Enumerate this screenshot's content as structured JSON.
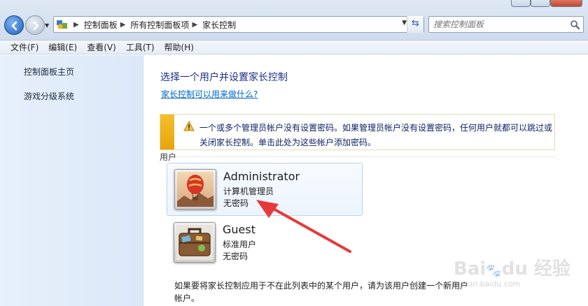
{
  "addressbar": {
    "breadcrumbs": [
      "控制面板",
      "所有控制面板项",
      "家长控制"
    ],
    "search_placeholder": "搜索控制面板"
  },
  "menubar": [
    "文件(F)",
    "编辑(E)",
    "查看(V)",
    "工具(T)",
    "帮助(H)"
  ],
  "sidebar": {
    "items": [
      {
        "label": "控制面板主页"
      },
      {
        "label": "游戏分级系统"
      }
    ]
  },
  "main": {
    "heading": "选择一个用户并设置家长控制",
    "help_link": "家长控制可以用来做什么?",
    "warning": "一个或多个管理员帐户没有设置密码。如果管理员帐户没有设置密码，任何用户就都可以跳过或关闭家长控制。单击此处为这些帐户添加密码。",
    "section_label": "用户",
    "users": [
      {
        "name": "Administrator",
        "role": "计算机管理员",
        "password": "无密码",
        "avatar": "hot-air-balloon"
      },
      {
        "name": "Guest",
        "role": "标准用户",
        "password": "无密码",
        "avatar": "suitcase"
      }
    ],
    "footnote": "如果要将家长控制应用于不在此列表中的某个用户，请为该用户创建一个新用户帐户。"
  },
  "annotation": {
    "color": "#e8393a"
  },
  "watermark": {
    "logo": "Bai du 经验",
    "url": "jingyan.baidu.com"
  }
}
